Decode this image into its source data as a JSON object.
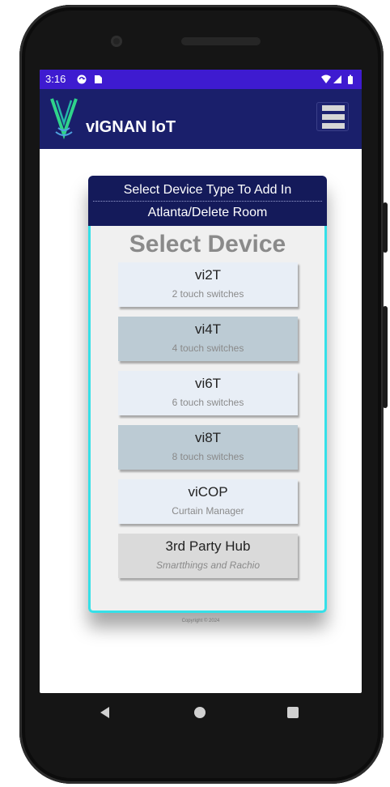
{
  "status_bar": {
    "time": "3:16",
    "icons": [
      "sync-icon",
      "sim-card-icon",
      "wifi-icon",
      "signal-icon",
      "battery-icon"
    ]
  },
  "app_bar": {
    "title": "vIGNAN IoT",
    "logo": "vignan-logo",
    "menu_icon": "hamburger-menu-icon"
  },
  "dialog": {
    "header_line1": "Select Device Type To Add In",
    "header_line2": "Atlanta/Delete Room",
    "title": "Select Device",
    "devices": [
      {
        "name": "vi2T",
        "sub": "2 touch switches",
        "style": "light"
      },
      {
        "name": "vi4T",
        "sub": "4 touch switches",
        "style": "dark"
      },
      {
        "name": "vi6T",
        "sub": "6 touch switches",
        "style": "light"
      },
      {
        "name": "vi8T",
        "sub": "8 touch switches",
        "style": "dark"
      },
      {
        "name": "viCOP",
        "sub": "Curtain Manager",
        "style": "light"
      },
      {
        "name": "3rd Party Hub",
        "sub": "Smartthings and Rachio",
        "style": "grey"
      }
    ]
  },
  "copyright": "Copyright © 2024",
  "nav_bar": {
    "back_icon": "back-triangle-icon",
    "home_icon": "home-circle-icon",
    "recents_icon": "recents-square-icon"
  },
  "colors": {
    "status_bar": "#3e1bd0",
    "app_bar": "#1a1f6b",
    "dialog_header": "#141a5a",
    "dialog_border": "#35e0e8"
  }
}
